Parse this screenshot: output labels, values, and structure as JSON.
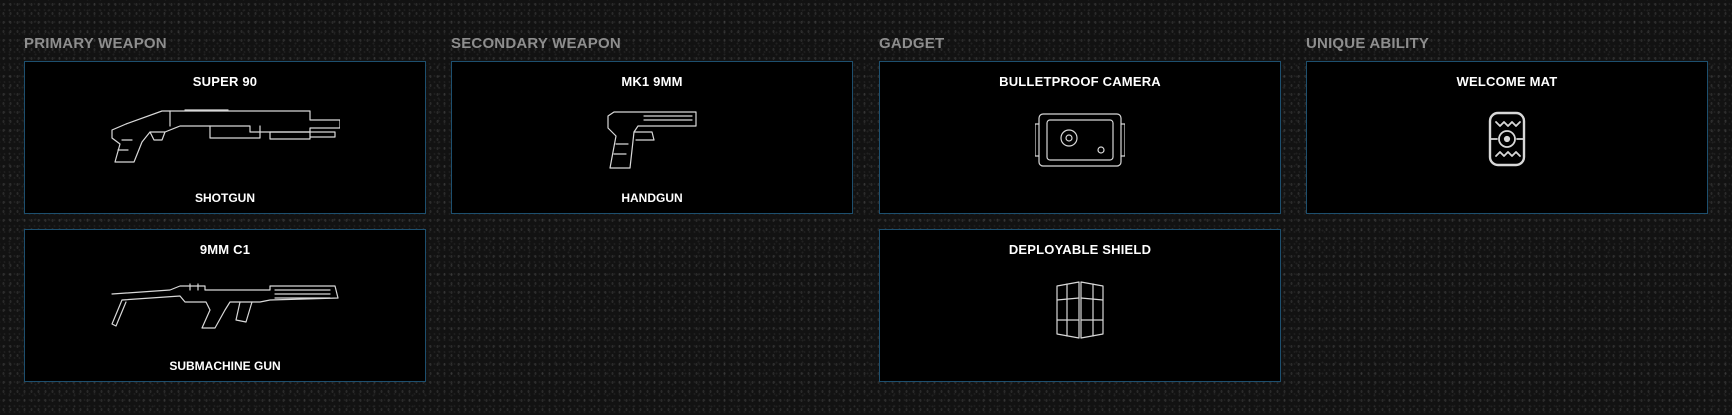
{
  "columns": {
    "primary": {
      "heading": "PRIMARY WEAPON",
      "cards": [
        {
          "name": "SUPER 90",
          "type": "SHOTGUN",
          "icon": "shotgun-icon"
        },
        {
          "name": "9MM C1",
          "type": "SUBMACHINE GUN",
          "icon": "submachine-gun-icon"
        }
      ]
    },
    "secondary": {
      "heading": "SECONDARY WEAPON",
      "cards": [
        {
          "name": "MK1 9MM",
          "type": "HANDGUN",
          "icon": "handgun-icon"
        }
      ]
    },
    "gadget": {
      "heading": "GADGET",
      "cards": [
        {
          "name": "BULLETPROOF CAMERA",
          "icon": "bulletproof-camera-icon"
        },
        {
          "name": "DEPLOYABLE SHIELD",
          "icon": "deployable-shield-icon"
        }
      ]
    },
    "ability": {
      "heading": "UNIQUE ABILITY",
      "cards": [
        {
          "name": "WELCOME MAT",
          "icon": "welcome-mat-icon"
        }
      ]
    }
  },
  "colors": {
    "background": "#121212",
    "card_background": "#000000",
    "card_border": "#1d4f6e",
    "heading": "#8e8e8e",
    "text": "#ffffff"
  }
}
